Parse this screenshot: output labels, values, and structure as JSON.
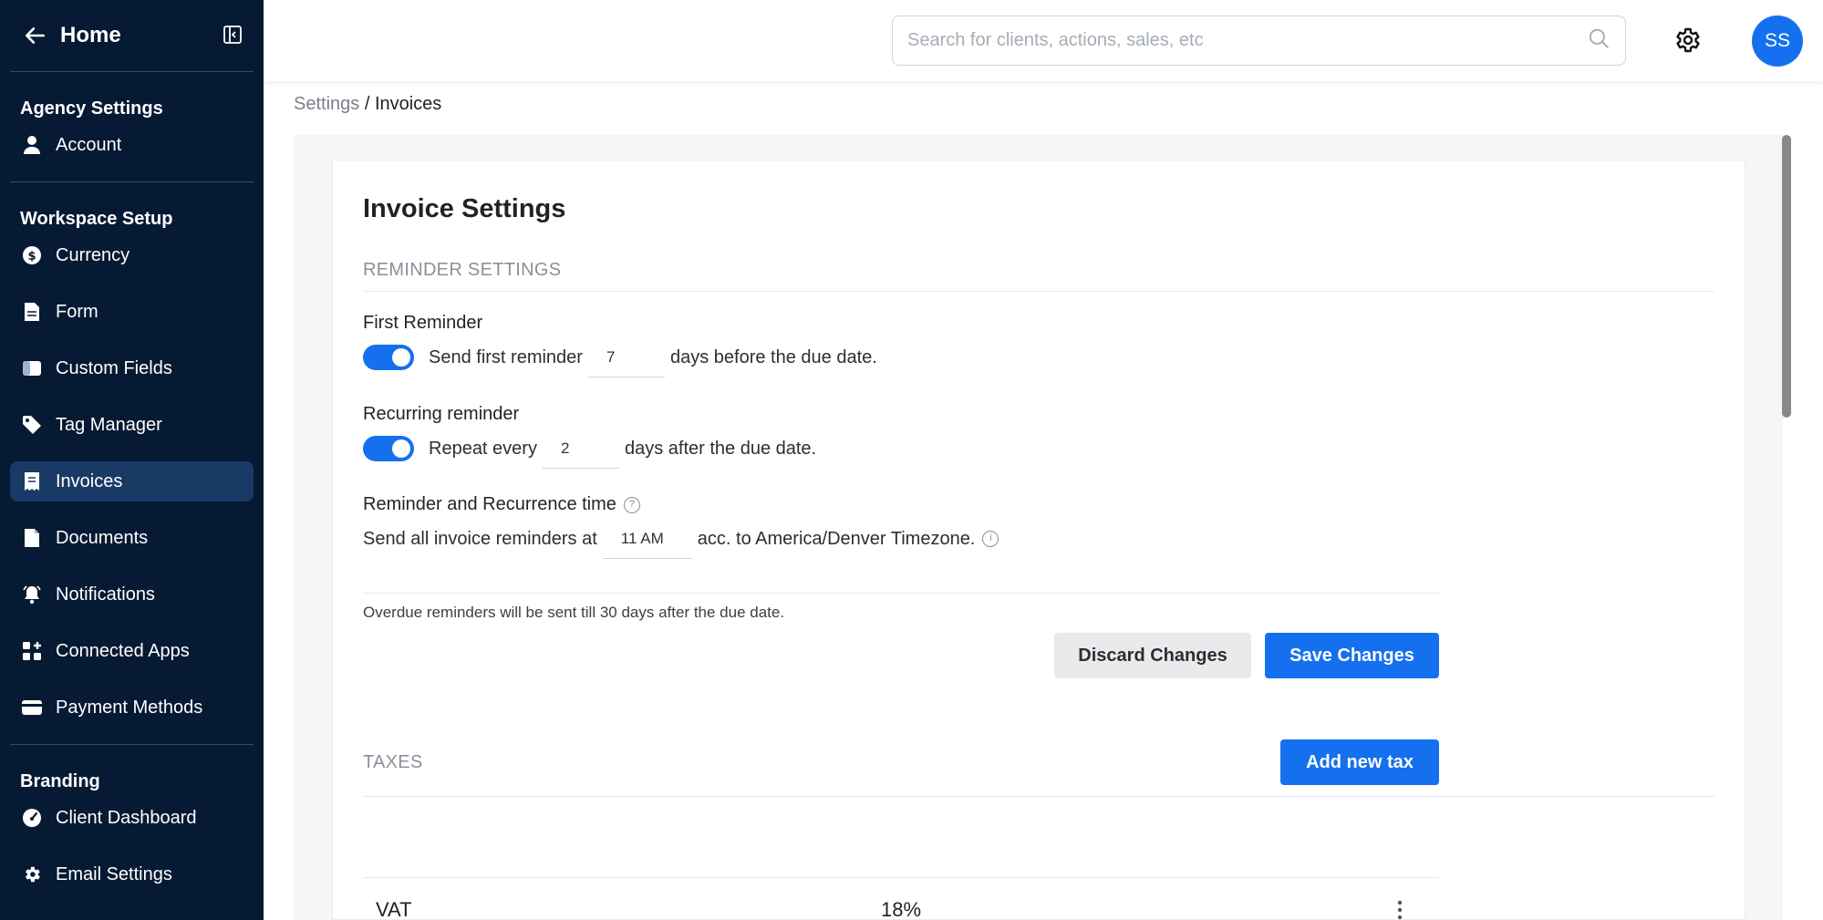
{
  "sidebar": {
    "home_label": "Home",
    "sections": [
      {
        "title": "Agency Settings"
      },
      {
        "title": "Workspace Setup"
      },
      {
        "title": "Branding"
      }
    ],
    "items": [
      {
        "label": "Account",
        "icon": "user-icon"
      },
      {
        "label": "Currency",
        "icon": "dollar-icon"
      },
      {
        "label": "Form",
        "icon": "document-icon"
      },
      {
        "label": "Custom Fields",
        "icon": "toggle-card-icon"
      },
      {
        "label": "Tag Manager",
        "icon": "tag-icon"
      },
      {
        "label": "Invoices",
        "icon": "receipt-icon",
        "active": true
      },
      {
        "label": "Documents",
        "icon": "document-icon"
      },
      {
        "label": "Notifications",
        "icon": "bell-icon"
      },
      {
        "label": "Connected Apps",
        "icon": "apps-icon"
      },
      {
        "label": "Payment Methods",
        "icon": "credit-card-icon"
      },
      {
        "label": "Client Dashboard",
        "icon": "dashboard-gauge-icon"
      },
      {
        "label": "Email Settings",
        "icon": "gear-icon"
      }
    ]
  },
  "header": {
    "search_placeholder": "Search for clients, actions, sales, etc",
    "avatar_initials": "SS"
  },
  "breadcrumb": {
    "parent": "Settings",
    "separator": " / ",
    "current": "Invoices"
  },
  "main": {
    "title": "Invoice Settings",
    "reminder_settings": {
      "heading": "REMINDER SETTINGS",
      "first_reminder": {
        "label": "First Reminder",
        "enabled": true,
        "prefix": "Send first reminder",
        "value": "7",
        "suffix": "days before the due date."
      },
      "recurring_reminder": {
        "label": "Recurring reminder",
        "enabled": true,
        "prefix": "Repeat every",
        "value": "2",
        "suffix": "days after the due date."
      },
      "time": {
        "label": "Reminder and Recurrence time",
        "prefix": "Send all invoice reminders at",
        "value": "11 AM",
        "suffix": "acc. to America/Denver Timezone."
      },
      "note": "Overdue reminders will be sent till 30 days after the due date.",
      "discard_label": "Discard Changes",
      "save_label": "Save Changes"
    },
    "taxes": {
      "heading": "TAXES",
      "add_label": "Add new tax",
      "rows": [
        {
          "name": "VAT",
          "rate": "18%"
        }
      ]
    }
  },
  "colors": {
    "sidebar_bg": "#061a33",
    "sidebar_active": "#1a3a66",
    "accent": "#1570ef"
  }
}
